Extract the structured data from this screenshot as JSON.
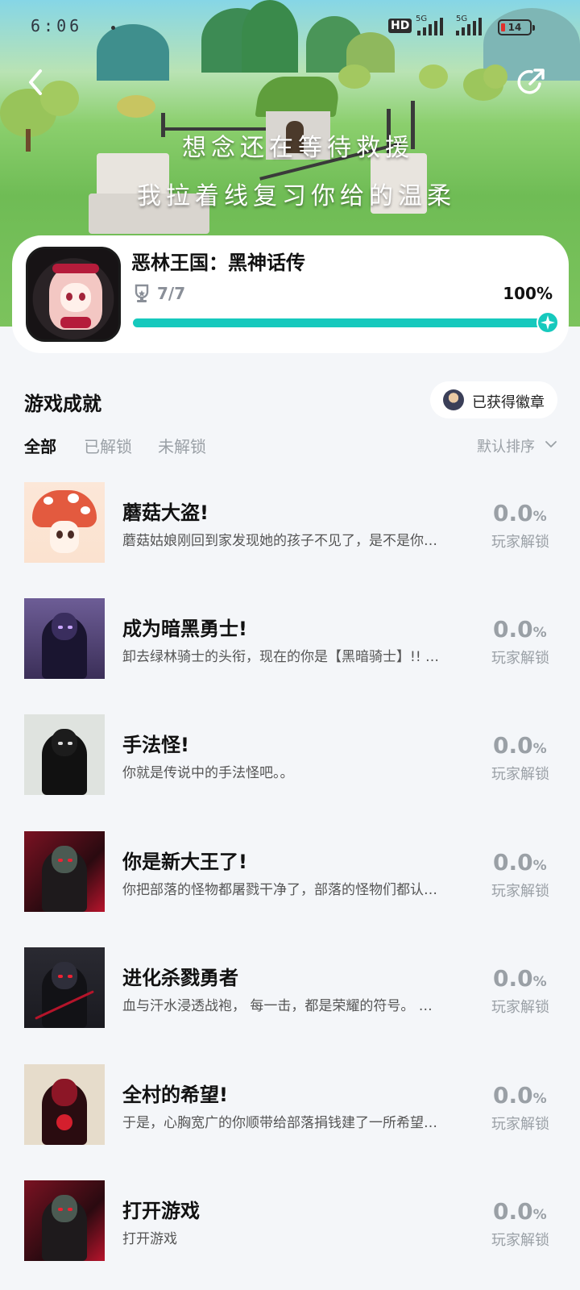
{
  "status_bar": {
    "time": "6:06",
    "network_hd": "HD",
    "net1": "5G",
    "net2": "5G",
    "battery": "14"
  },
  "hero": {
    "lyric_line1": "想念还在等待救援",
    "lyric_line2": "我拉着线复习你给的温柔"
  },
  "game": {
    "title": "恶林王国：黑神话传",
    "trophies": "7/7",
    "progress_percent_label": "100%",
    "progress": 1.0
  },
  "section": {
    "title": "游戏成就",
    "badge_button": "已获得徽章",
    "tabs": [
      {
        "label": "全部",
        "active": true
      },
      {
        "label": "已解锁",
        "active": false
      },
      {
        "label": "未解锁",
        "active": false
      }
    ],
    "sort_label": "默认排序"
  },
  "achievements": [
    {
      "title": "蘑菇大盗!",
      "desc": "蘑菇姑娘刚回到家发现她的孩子不见了，是不是你…",
      "rate": "0.0",
      "rate_unit": "%",
      "rate_label": "玩家解锁"
    },
    {
      "title": "成为暗黑勇士!",
      "desc": "卸去绿林骑士的头衔，现在的你是【黑暗骑士】!! …",
      "rate": "0.0",
      "rate_unit": "%",
      "rate_label": "玩家解锁"
    },
    {
      "title": "手法怪!",
      "desc": "你就是传说中的手法怪吧。。",
      "rate": "0.0",
      "rate_unit": "%",
      "rate_label": "玩家解锁"
    },
    {
      "title": "你是新大王了!",
      "desc": "你把部落的怪物都屠戮干净了，部落的怪物们都认…",
      "rate": "0.0",
      "rate_unit": "%",
      "rate_label": "玩家解锁"
    },
    {
      "title": "进化杀戮勇者",
      "desc": "血与汗水浸透战袍， 每一击，都是荣耀的符号。 …",
      "rate": "0.0",
      "rate_unit": "%",
      "rate_label": "玩家解锁"
    },
    {
      "title": "全村的希望!",
      "desc": "于是，心胸宽广的你顺带给部落捐钱建了一所希望…",
      "rate": "0.0",
      "rate_unit": "%",
      "rate_label": "玩家解锁"
    },
    {
      "title": "打开游戏",
      "desc": "打开游戏",
      "rate": "0.0",
      "rate_unit": "%",
      "rate_label": "玩家解锁"
    }
  ],
  "colors": {
    "accent": "#16c9bd",
    "background": "#f4f6f9"
  }
}
